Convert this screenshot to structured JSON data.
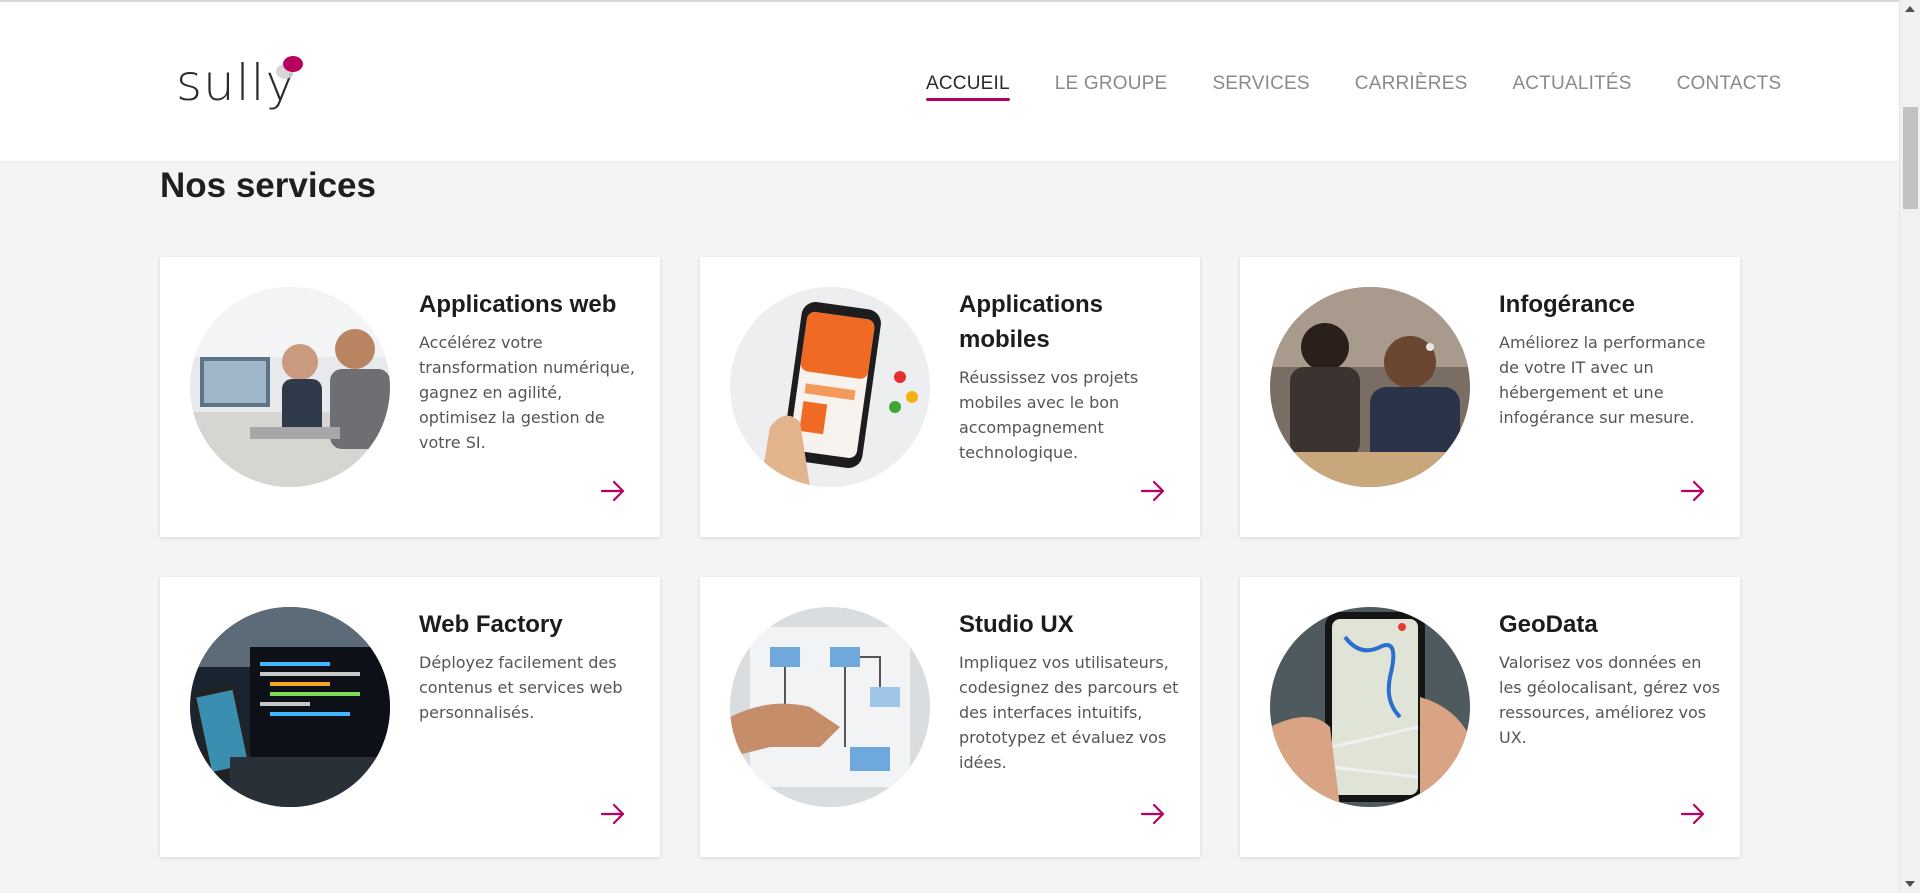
{
  "header": {
    "logo_text": "sully",
    "nav": [
      "ACCUEIL",
      "LE GROUPE",
      "SERVICES",
      "CARRIÈRES",
      "ACTUALITÉS",
      "CONTACTS"
    ],
    "active_index": 0
  },
  "colors": {
    "accent": "#b8005f",
    "background": "#f4f4f4",
    "card": "#ffffff"
  },
  "section": {
    "title": "Nos services"
  },
  "services": [
    {
      "title": "Applications web",
      "description": "Accélérez votre transformation numérique, gagnez en agilité, optimisez la gestion de votre SI.",
      "image": "office-developers-photo",
      "icon": "arrow-right-icon"
    },
    {
      "title": "Applications mobiles",
      "description": "Réussissez vos projets mobiles avec le bon accompagnement technologique.",
      "image": "smartphone-app-photo",
      "icon": "arrow-right-icon"
    },
    {
      "title": "Infogérance",
      "description": "Améliorez la performance de votre IT avec un hébergement et une infogérance sur mesure.",
      "image": "support-team-photo",
      "icon": "arrow-right-icon"
    },
    {
      "title": "Web Factory",
      "description": "Déployez facilement des contenus et services web personnalisés.",
      "image": "code-laptop-photo",
      "icon": "arrow-right-icon"
    },
    {
      "title": "Studio UX",
      "description": "Impliquez vos utilisateurs, codesignez des parcours et des interfaces intuitifs, prototypez et évaluez vos idées.",
      "image": "ux-board-photo",
      "icon": "arrow-right-icon"
    },
    {
      "title": "GeoData",
      "description": "Valorisez vos données en les géolocalisant, gérez vos ressources, améliorez vos UX.",
      "image": "phone-map-photo",
      "icon": "arrow-right-icon"
    }
  ]
}
